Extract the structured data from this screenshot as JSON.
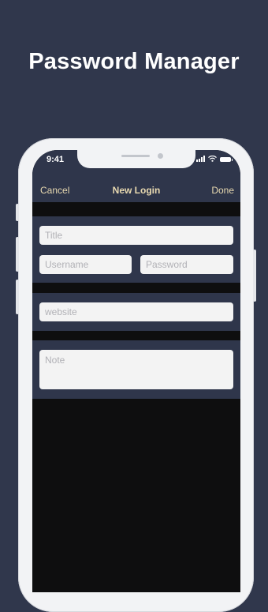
{
  "promo": {
    "headline": "Password Manager"
  },
  "status_bar": {
    "time": "9:41",
    "icons": [
      "cellular-signal-icon",
      "wifi-icon",
      "battery-icon"
    ]
  },
  "nav": {
    "cancel_label": "Cancel",
    "title": "New Login",
    "done_label": "Done"
  },
  "form": {
    "title_placeholder": "Title",
    "username_placeholder": "Username",
    "password_placeholder": "Password",
    "website_placeholder": "website",
    "note_placeholder": "Note"
  },
  "colors": {
    "background": "#30374c",
    "section": "#2f364b",
    "screen_fill": "#0e0e0f",
    "nav_accent": "#e8d9b0",
    "field": "#f3f3f3",
    "placeholder": "#b1b1b6"
  }
}
